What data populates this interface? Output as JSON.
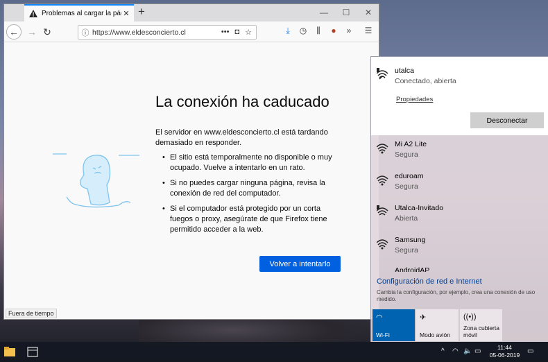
{
  "browser": {
    "tab_title": "Problemas al cargar la página",
    "url": "https://www.eldesconcierto.cl",
    "status": "Fuera de tiempo"
  },
  "error_page": {
    "title": "La conexión ha caducado",
    "description": "El servidor en www.eldesconcierto.cl está tardando demasiado en responder.",
    "bullets": [
      "El sitio está temporalmente no disponible o muy ocupado. Vuelve a intentarlo en un rato.",
      "Si no puedes cargar ninguna página, revisa la conexión de red del computador.",
      "Si el computador está protegido por un corta fuegos o proxy, asegúrate de que Firefox tiene permitido acceder a la web."
    ],
    "retry_label": "Volver a intentarlo"
  },
  "network": {
    "connected": {
      "name": "utalca",
      "status": "Conectado, abierta",
      "properties_label": "Propiedades",
      "disconnect_label": "Desconectar"
    },
    "list": [
      {
        "name": "Mi A2 Lite",
        "status": "Segura"
      },
      {
        "name": "eduroam",
        "status": "Segura"
      },
      {
        "name": "Utalca-Invitado",
        "status": "Abierta"
      },
      {
        "name": "Samsung",
        "status": "Segura"
      }
    ],
    "partial_item": "AndroidAP",
    "settings_link": "Configuración de red e Internet",
    "settings_sub": "Cambia la configuración, por ejemplo, crea una conexión de uso medido.",
    "quick_actions": [
      {
        "label": "Wi-Fi",
        "icon": "wifi-icon"
      },
      {
        "label": "Modo avión",
        "icon": "airplane-icon"
      },
      {
        "label": "Zona cubierta móvil",
        "icon": "hotspot-icon"
      }
    ]
  },
  "taskbar": {
    "time": "11:44",
    "date": "05-06-2019"
  },
  "colors": {
    "accent": "#0060df",
    "wifi_tile": "#0063b1",
    "tab_highlight": "#0a84ff"
  }
}
